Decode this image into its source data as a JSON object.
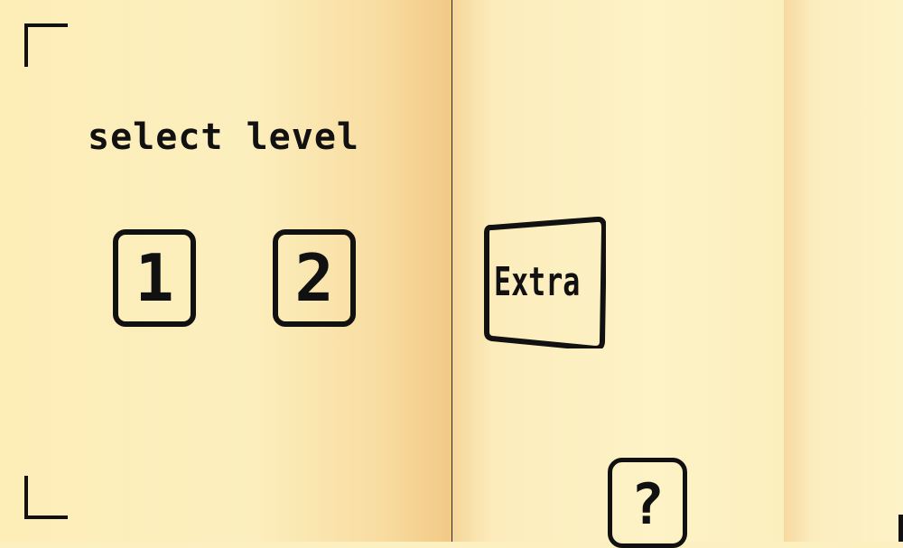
{
  "menu": {
    "title": "select level",
    "levels": [
      "1",
      "2"
    ],
    "extra_label": "Extra",
    "help_label": "?"
  }
}
